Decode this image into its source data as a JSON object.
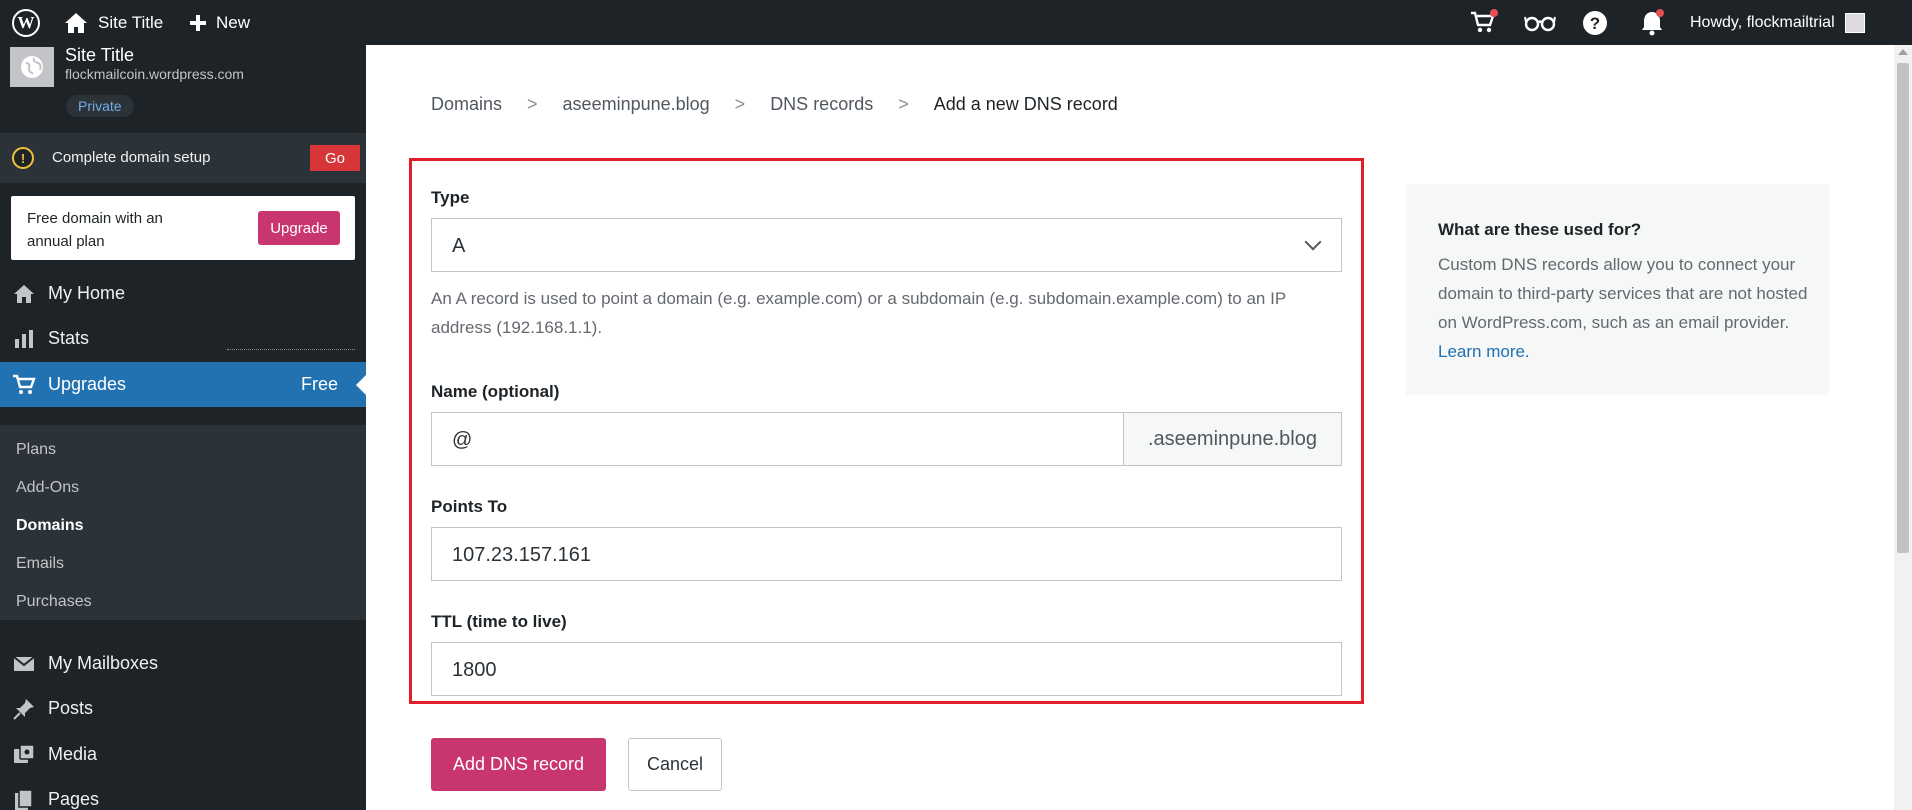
{
  "adminbar": {
    "site_title": "Site Title",
    "new_label": "New",
    "howdy": "Howdy, flockmailtrial",
    "icons": [
      "wordpress-icon",
      "home-icon",
      "plus-icon",
      "cart-icon",
      "reader-icon",
      "help-icon",
      "bell-icon"
    ]
  },
  "sidebar": {
    "site_title": "Site Title",
    "site_url": "flockmailcoin.wordpress.com",
    "privacy_badge": "Private",
    "domain_setup_label": "Complete domain setup",
    "domain_setup_button": "Go",
    "upgrade_text": "Free domain with an annual plan",
    "upgrade_button": "Upgrade",
    "menu": {
      "my_home": "My Home",
      "stats": "Stats",
      "upgrades": "Upgrades",
      "upgrades_badge": "Free",
      "my_mailboxes": "My Mailboxes",
      "posts": "Posts",
      "media": "Media",
      "pages": "Pages"
    },
    "submenu": {
      "plans": "Plans",
      "addons": "Add-Ons",
      "domains": "Domains",
      "emails": "Emails",
      "purchases": "Purchases"
    }
  },
  "breadcrumb": {
    "items": [
      "Domains",
      "aseeminpune.blog",
      "DNS records",
      "Add a new DNS record"
    ],
    "separator": ">"
  },
  "form": {
    "type_label": "Type",
    "type_value": "A",
    "type_help": "An A record is used to point a domain (e.g. example.com) or a subdomain (e.g. subdomain.example.com) to an IP address (192.168.1.1).",
    "name_label": "Name (optional)",
    "name_value": "@",
    "name_suffix": ".aseeminpune.blog",
    "points_to_label": "Points To",
    "points_to_value": "107.23.157.161",
    "ttl_label": "TTL (time to live)",
    "ttl_value": "1800",
    "submit_label": "Add DNS record",
    "cancel_label": "Cancel"
  },
  "info": {
    "title": "What are these used for?",
    "body": "Custom DNS records allow you to connect your domain to third-party services that are not hosted on WordPress.com, such as an email provider.",
    "link": "Learn more."
  },
  "colors": {
    "adminbar_bg": "#1d2327",
    "active_menu": "#2271b1",
    "accent_pink": "#c9356e",
    "highlight_border": "#e01f2a",
    "go_button": "#d63638"
  }
}
